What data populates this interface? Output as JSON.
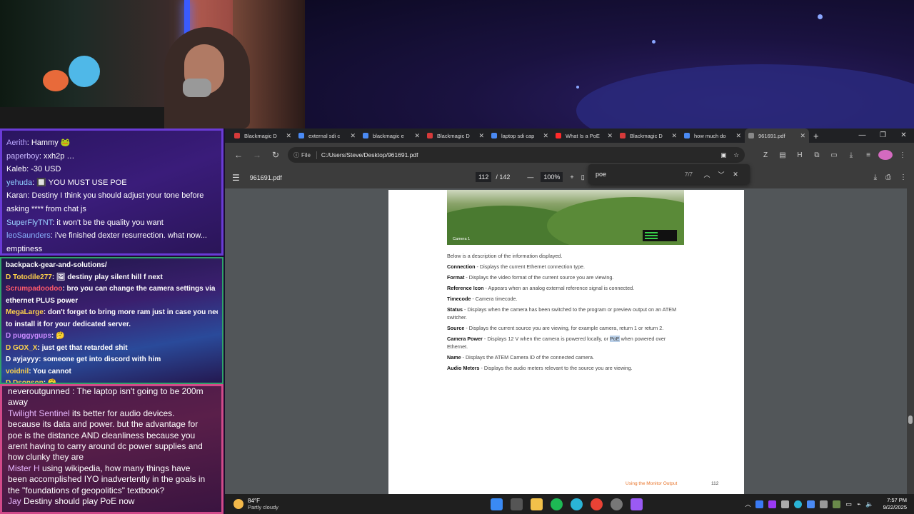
{
  "chat_top": [
    {
      "user": "Aerith",
      "color": "#b9a6ff",
      "text": ": Hammy 🐸"
    },
    {
      "user": "paperboy",
      "color": "#c9b8ff",
      "text": ": xxh2p …"
    },
    {
      "user": "Kaleb",
      "color": "#ffffff",
      "text": ": -30 USD"
    },
    {
      "user": "yehuda",
      "color": "#8fd0ff",
      "text": ": 🔲 YOU MUST USE POE"
    },
    {
      "user": "Karan",
      "color": "#ffffff",
      "text": ": Destiny I think you should adjust your tone before"
    },
    {
      "user": "",
      "color": "#ffffff",
      "text": "asking **** from chat js"
    },
    {
      "user": "SuperFlyTNT",
      "color": "#9ad0ff",
      "text": ": it won't be the quality you want"
    },
    {
      "user": "leoSaunders",
      "color": "#8ab4ff",
      "text": ": i've finished dexter resurrection. what now..."
    },
    {
      "user": "",
      "color": "#ffffff",
      "text": "emptiness"
    }
  ],
  "chat_mid": [
    {
      "user": "",
      "color": "#ffffff",
      "text": "backpack-gear-and-solutions/"
    },
    {
      "user": "D Totodile277",
      "color": "#ffd24a",
      "text": ": 🖼 destiny play silent hill f next"
    },
    {
      "user": "Scrumpadoodoo",
      "color": "#ff5a6a",
      "text": ": bro you can change the camera settings via"
    },
    {
      "user": "",
      "color": "#ffffff",
      "text": "ethernet PLUS power"
    },
    {
      "user": "MegaLarge",
      "color": "#ffd24a",
      "text": ": don't forget to bring more ram just in case you need"
    },
    {
      "user": "",
      "color": "#ffffff",
      "text": "to install it for your dedicated server."
    },
    {
      "user": "D puggygups",
      "color": "#c98aff",
      "text": ": 🤔"
    },
    {
      "user": "D GOX_X",
      "color": "#ffd24a",
      "text": ": just get that retarded shit"
    },
    {
      "user": "D ayjayyy",
      "color": "#ffffff",
      "text": ": someone get into discord with him"
    },
    {
      "user": "voidnil",
      "color": "#ffd24a",
      "text": ": You cannot"
    },
    {
      "user": "D Dsonson",
      "color": "#ffd24a",
      "text": ": 🤔"
    }
  ],
  "chat_bot": [
    {
      "user": "",
      "text": "neveroutgunned : The laptop isn't going to be 200m"
    },
    {
      "user": "",
      "text": "away"
    },
    {
      "user": "Twilight Sentinel",
      "text": " its better for audio devices."
    },
    {
      "user": "",
      "text": "because its data and power. but the advantage for"
    },
    {
      "user": "",
      "text": "poe is the distance AND cleanliness because you"
    },
    {
      "user": "",
      "text": "arent having to carry around dc power supplies and"
    },
    {
      "user": "",
      "text": "how clunky they are"
    },
    {
      "user": "Mister H",
      "text": " using wikipedia, how many things have"
    },
    {
      "user": "",
      "text": "been accomplished IYO inadvertently in the goals in"
    },
    {
      "user": "",
      "text": "the \"foundations of geopolitics\" textbook?"
    },
    {
      "user": "Jay",
      "text": " Destiny should play PoE now"
    }
  ],
  "tabs": [
    {
      "title": "Blackmagic D",
      "fav": "#d63a3a"
    },
    {
      "title": "external sdi c",
      "fav": "#4a8af4"
    },
    {
      "title": "blackmagic e",
      "fav": "#4a8af4"
    },
    {
      "title": "Blackmagic D",
      "fav": "#d63a3a"
    },
    {
      "title": "laptop sdi cap",
      "fav": "#4a8af4"
    },
    {
      "title": "What Is a PoE",
      "fav": "#ff2a2a"
    },
    {
      "title": "Blackmagic D",
      "fav": "#d63a3a"
    },
    {
      "title": "how much do",
      "fav": "#4a8af4"
    },
    {
      "title": "961691.pdf",
      "fav": "#888888"
    }
  ],
  "address": {
    "chip": "File",
    "url": "C:/Users/Steve/Desktop/961691.pdf"
  },
  "pdf": {
    "filename": "961691.pdf",
    "page": "112",
    "total": "/ 142",
    "zoom": "100%",
    "find_query": "poe",
    "find_count": "7/7"
  },
  "doc": {
    "camera_label": "Camera 1",
    "intro": "Below is a description of the information displayed.",
    "items": [
      {
        "term": "Connection",
        "desc": " - Displays the current Ethernet connection type."
      },
      {
        "term": "Format",
        "desc": " - Displays the video format of the current source you are viewing."
      },
      {
        "term": "Reference Icon",
        "desc": " - Appears when an analog external reference signal is connected."
      },
      {
        "term": "Timecode",
        "desc": " - Camera timecode."
      },
      {
        "term": "Status",
        "desc": " - Displays when the camera has been switched to the program or preview output on an ATEM switcher."
      },
      {
        "term": "Source",
        "desc": " - Displays the current source you are viewing, for example camera, return 1 or return 2."
      },
      {
        "term": "Camera Power",
        "desc_before": " - Displays 12 V when the camera is powered locally, or ",
        "highlight": "PoE",
        "desc_after": " when powered over Ethernet."
      },
      {
        "term": "Name",
        "desc": " - Displays the ATEM Camera ID of the connected camera."
      },
      {
        "term": "Audio Meters",
        "desc": " - Displays the audio meters relevant to the source you are viewing."
      }
    ],
    "footer": "Using the Monitor Output",
    "page_number": "112"
  },
  "taskbar": {
    "temp": "84°F",
    "weather": "Partly cloudy",
    "time": "7:57 PM",
    "date": "9/22/2025"
  }
}
